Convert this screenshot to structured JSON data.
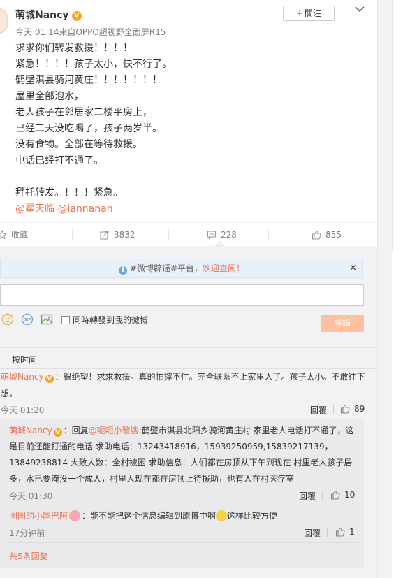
{
  "post": {
    "username": "萌城Nancy",
    "verified_mark": "V",
    "follow_plus": "+",
    "follow_label": "關注",
    "meta": "今天 01:14来自OPPO超视野全面屏R15",
    "lines": [
      "求求你们转发救援！！！！",
      "紧急！！！！孩子太小，快不行了。",
      "鹤壁淇县骑河黄庄！！！！！！！",
      "屋里全部泡水，",
      "老人孩子在邻居家二楼平房上，",
      "已经二天没吃喝了，孩子两岁半。",
      "没有食物。全部在等待救援。",
      "电话已经打不通了。",
      "",
      "拜托转发。！！！紧急。"
    ],
    "mentions": [
      "@瞿天临",
      "@iannanan"
    ]
  },
  "actions": {
    "favorite": "收藏",
    "repost_count": "3832",
    "comment_count": "228",
    "like_count": "855"
  },
  "notice": {
    "prefix": "#微博辟谣#平台，",
    "link": "欢迎查阅！",
    "close": "×"
  },
  "composer": {
    "input_value": "",
    "gif_label": "GIF",
    "sync_label": "同時轉發到我的微博",
    "submit_label": "評論"
  },
  "sort": {
    "label": "按时间"
  },
  "comments": [
    {
      "user": "萌城Nancy",
      "verified_mark": "V",
      "text_line1": "：很绝望！求求救援。真的怕撑不住。完全联系不上家里人了。孩子太小。不敢往下",
      "text_line2": "想。",
      "time": "今天 01:20",
      "reply_label": "回覆",
      "likes": "89"
    }
  ],
  "sub_replies": [
    {
      "user": "萌城Nancy",
      "verified_mark": "V",
      "reply_prefix": "：回复",
      "reply_to": "@呃呃小警嫂",
      "line1": ":鹤壁市淇县北阳乡骑河黄庄村 家里老人电话打不通了，这",
      "line2": "是目前还能打通的电话 求助电话：13243418916，15939250959,15839217139，",
      "line3": "13849238814 大致人数：全村被困 求助信息：人们都在房顶从下午到现在 村里老人孩子居",
      "line4": "多，水已要淹没一个成人，村里人现在都在房顶上待援助，也有人在村医疗室",
      "time": "今天 01:30",
      "reply_label": "回覆",
      "likes": "10"
    },
    {
      "user": "图图的小尾巴阿",
      "text_a": "：能不能把这个信息编辑到原博中啊",
      "text_b": "这样比较方便",
      "time": "17分钟前",
      "reply_label": "回覆",
      "likes": "1"
    }
  ],
  "more_replies": "共5条回复",
  "colors": {
    "accent": "#eb7350",
    "badge": "#f5a623",
    "submit_disabled": "#ffc09f",
    "notice_bg": "#e8f0f9",
    "comment_bg": "#f2f2f5"
  },
  "icons": [
    "chevron-down-icon",
    "star-icon",
    "repost-icon",
    "comment-icon",
    "thumb-up-icon",
    "info-icon",
    "smiley-icon",
    "gif-icon",
    "image-icon"
  ]
}
